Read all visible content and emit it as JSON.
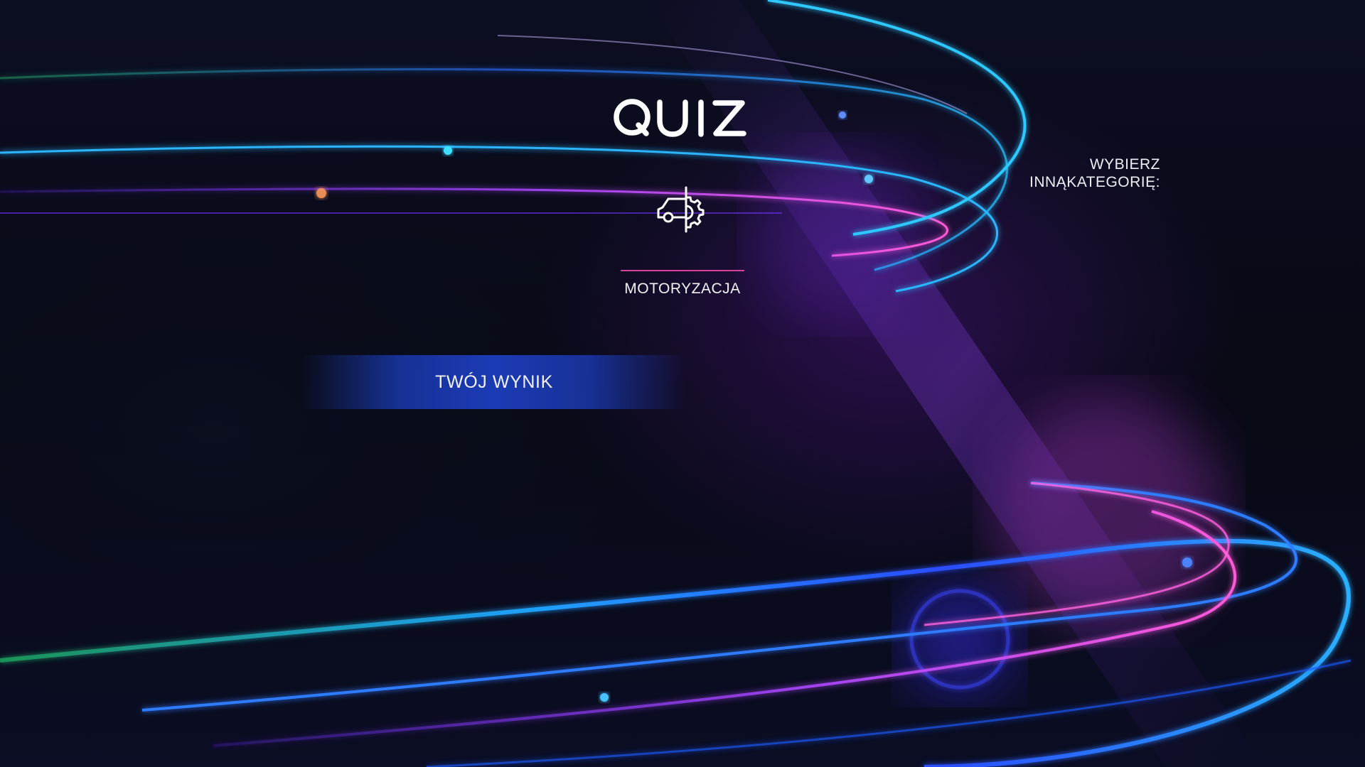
{
  "app": {
    "logo_text": "QUIZ"
  },
  "category": {
    "name": "MOTORYZACJA",
    "icon": "car-gear-icon"
  },
  "other_category": {
    "line1": "WYBIERZ",
    "line2": "INNĄKATEGORIĘ:"
  },
  "score": {
    "label": "TWÓJ WYNIK"
  },
  "colors": {
    "accent_pink": "#d6429a",
    "score_bar_blue": "#1c3ebe",
    "background": "#0a0b1a",
    "light_cyan": "#2aa8ff",
    "light_violet": "#b048ff"
  }
}
